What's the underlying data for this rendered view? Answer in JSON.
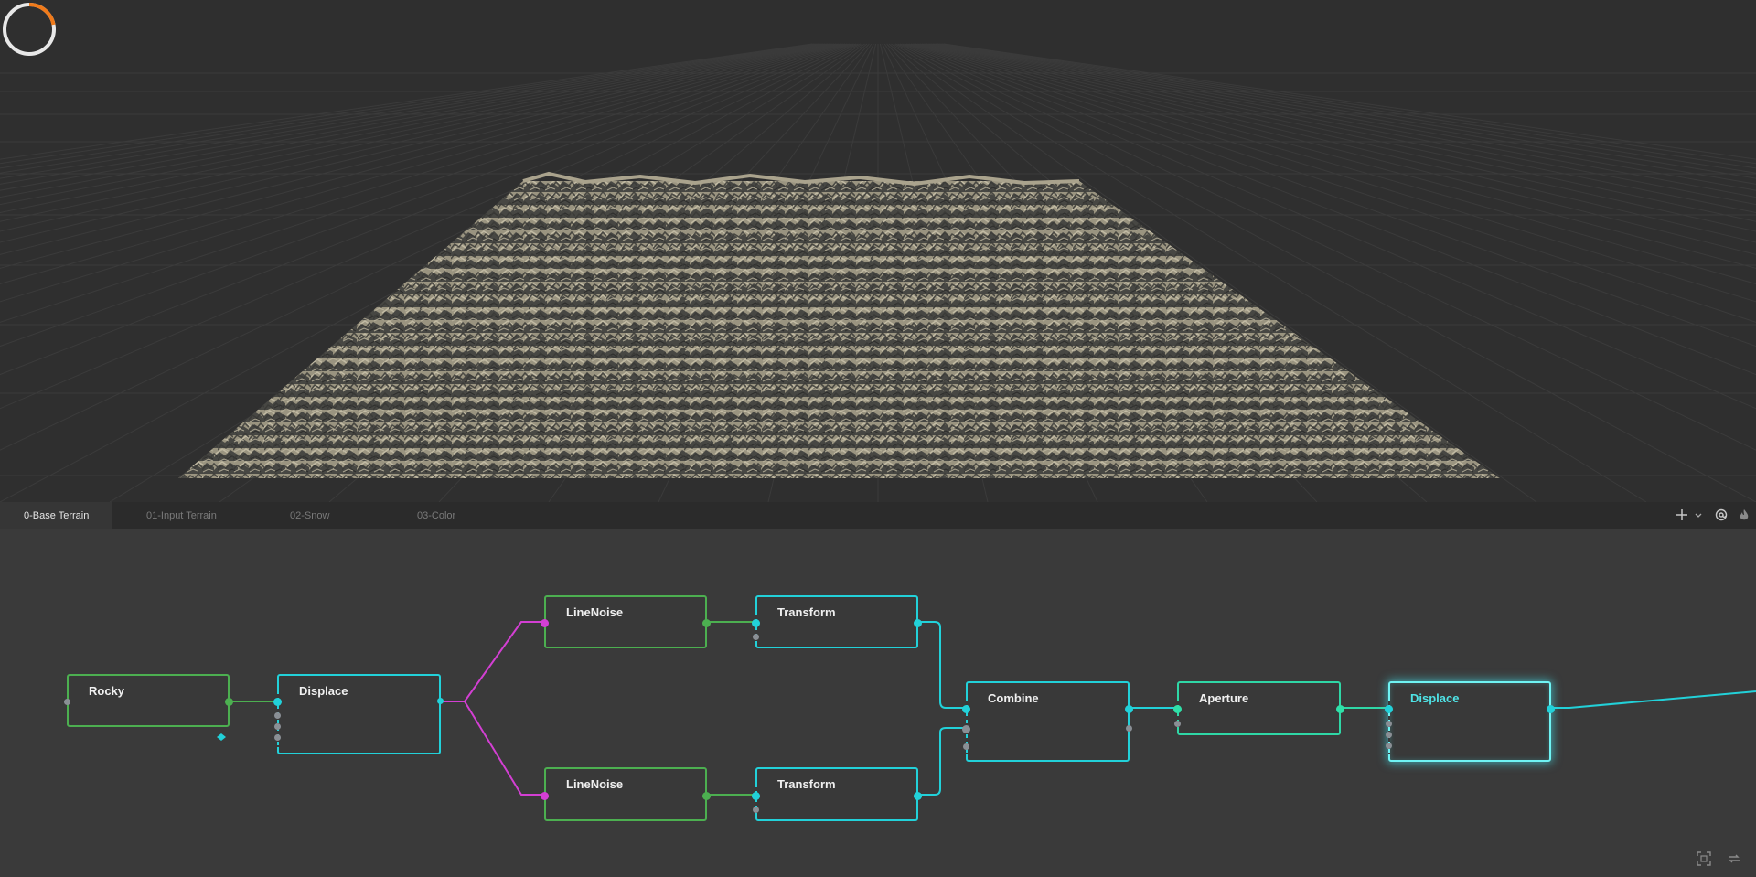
{
  "tabs": [
    {
      "label": "0-Base Terrain",
      "active": true
    },
    {
      "label": "01-Input Terrain",
      "active": false
    },
    {
      "label": "02-Snow",
      "active": false
    },
    {
      "label": "03-Color",
      "active": false
    }
  ],
  "toolbar_icons": [
    "plus-icon",
    "chevron-down-icon",
    "at-icon",
    "flame-icon"
  ],
  "bottom_icons": [
    "fit-view-icon",
    "refresh-icon"
  ],
  "progress": {
    "fraction": 0.22,
    "color": "#f07a1a"
  },
  "nodes": {
    "rocky": {
      "title": "Rocky"
    },
    "displace1": {
      "title": "Displace"
    },
    "linenoise1": {
      "title": "LineNoise"
    },
    "transform1": {
      "title": "Transform"
    },
    "linenoise2": {
      "title": "LineNoise"
    },
    "transform2": {
      "title": "Transform"
    },
    "combine": {
      "title": "Combine"
    },
    "aperture": {
      "title": "Aperture"
    },
    "displace2": {
      "title": "Displace"
    }
  },
  "colors": {
    "viewport_bg": "#2f2f2f",
    "graph_bg": "#3a3a3a",
    "node_green": "#4caf50",
    "node_cyan": "#22d1d9",
    "node_teal": "#2fd7a6",
    "wire_magenta": "#d33fd3",
    "terrain": "#b5ad96"
  }
}
